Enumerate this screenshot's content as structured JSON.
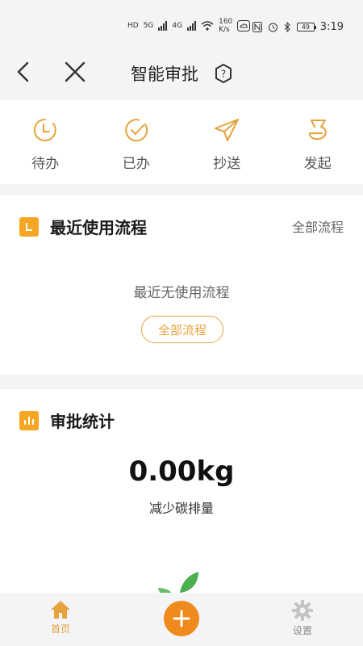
{
  "status_bar": {
    "network_speed": "160\nK/s",
    "speed_value": "160",
    "speed_unit": "K/s",
    "battery": "49",
    "time": "3:19",
    "net_labels": [
      "HD",
      "5G",
      "4G"
    ]
  },
  "header": {
    "title": "智能审批",
    "icons": [
      "back-arrow-icon",
      "close-icon",
      "help-icon"
    ]
  },
  "quick_actions": [
    {
      "label": "待办",
      "icon": "clock-icon"
    },
    {
      "label": "已办",
      "icon": "check-circle-icon"
    },
    {
      "label": "抄送",
      "icon": "paper-plane-icon"
    },
    {
      "label": "发起",
      "icon": "initiate-icon"
    }
  ],
  "recent": {
    "title": "最近使用流程",
    "all_link": "全部流程",
    "empty_text": "最近无使用流程",
    "all_button": "全部流程"
  },
  "stats": {
    "title": "审批统计",
    "value": "0.00kg",
    "label": "减少碳排量"
  },
  "bottom_nav": {
    "home_label": "首页",
    "settings_label": "设置"
  },
  "colors": {
    "accent": "#f5a623",
    "button_orange": "#ef8a1c",
    "background": "#f4f4f6"
  }
}
